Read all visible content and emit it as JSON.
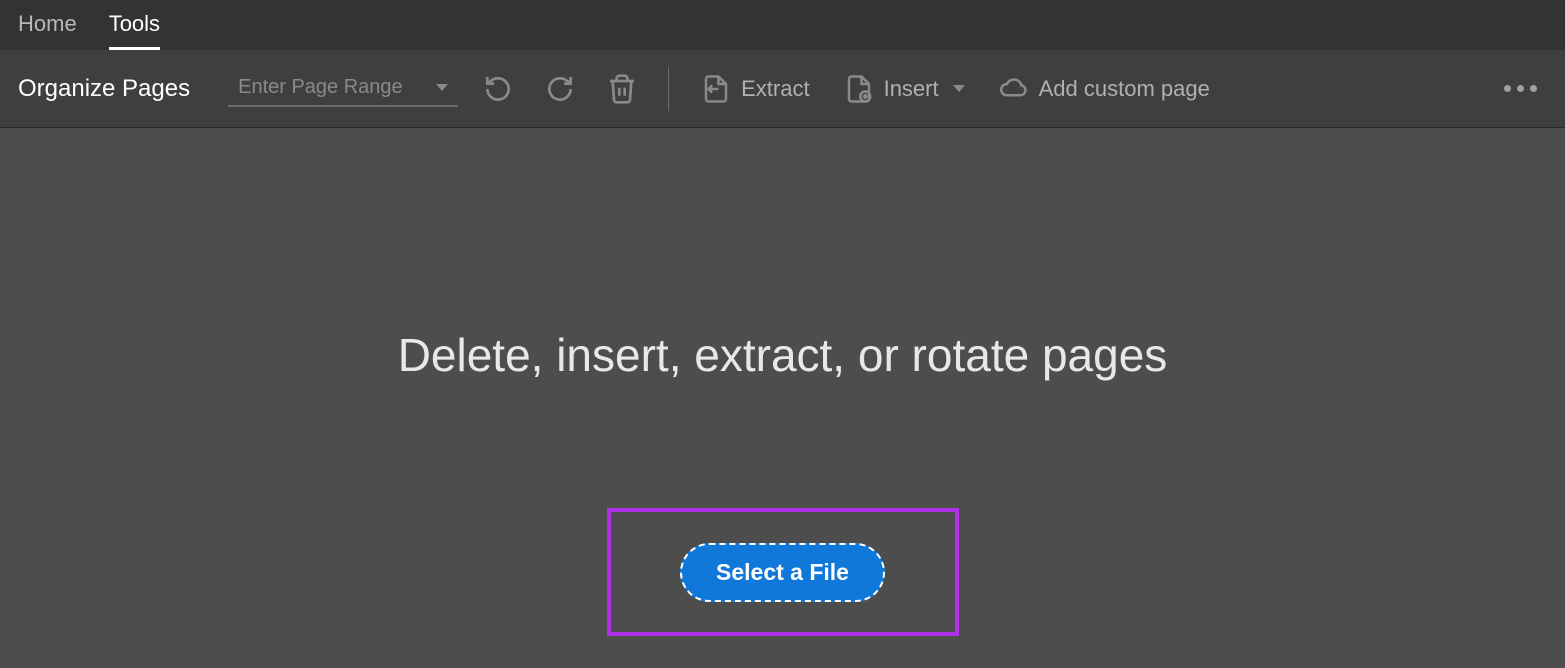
{
  "tabs": {
    "home": "Home",
    "tools": "Tools"
  },
  "toolbar": {
    "title": "Organize Pages",
    "page_range_placeholder": "Enter Page Range",
    "extract_label": "Extract",
    "insert_label": "Insert",
    "add_custom_label": "Add custom page"
  },
  "main": {
    "headline": "Delete, insert, extract, or rotate pages",
    "select_file_label": "Select a File"
  }
}
